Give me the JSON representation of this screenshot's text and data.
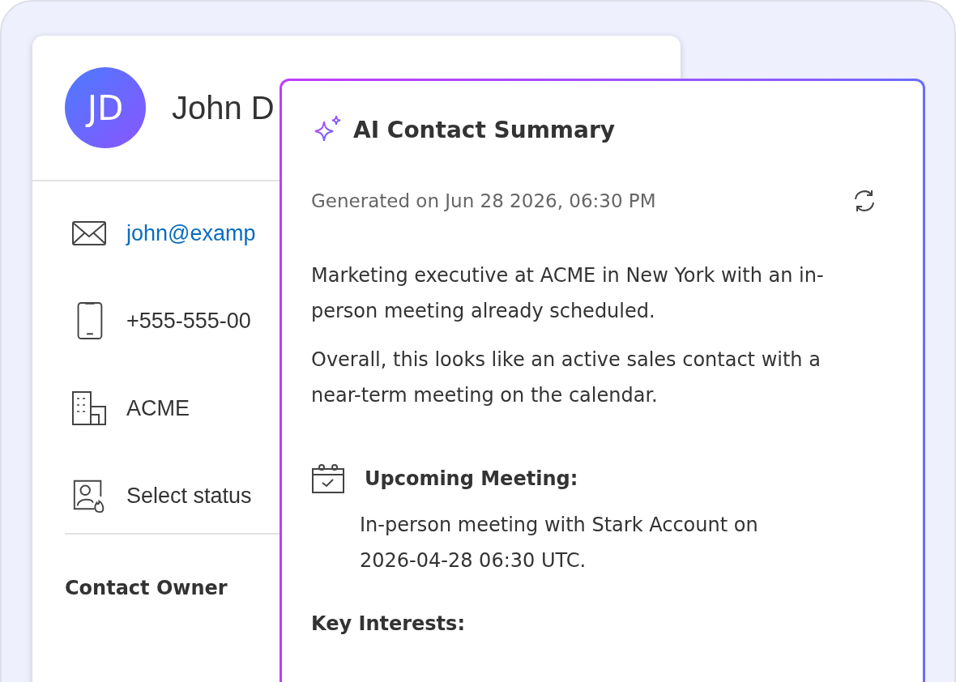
{
  "contact": {
    "avatar_initials": "JD",
    "name": "John D",
    "fields": [
      {
        "kind": "email",
        "value": "john@examp"
      },
      {
        "kind": "phone",
        "value": "+555-555-00"
      },
      {
        "kind": "company",
        "value": "ACME"
      },
      {
        "kind": "status",
        "value": "Select status"
      }
    ],
    "owner_label": "Contact Owner"
  },
  "summary": {
    "title": "AI Contact Summary",
    "generated": "Generated on Jun 28 2026, 06:30 PM",
    "paragraphs": [
      "Marketing executive at ACME in New York with an in-person meeting already scheduled.",
      "Overall, this looks like an active sales contact with a near-term meeting on the calendar."
    ],
    "meeting": {
      "heading": "Upcoming Meeting:",
      "text": "In-person meeting with Stark Account on 2026-04-28 06:30 UTC."
    },
    "key_interests_heading": "Key Interests:"
  }
}
